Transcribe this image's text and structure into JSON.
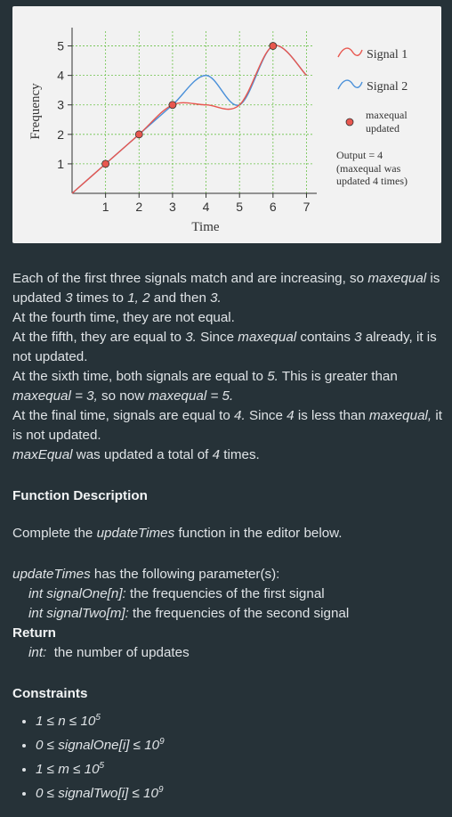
{
  "figure": {
    "ylabel": "Frequency",
    "xlabel": "Time",
    "legend": {
      "signal1": "Signal 1",
      "signal2": "Signal 2",
      "marker_line1": "maxequal",
      "marker_line2": "updated"
    },
    "annotation": {
      "line1": "Output = 4",
      "line2": "(maxequal was",
      "line3": "updated 4 times)"
    },
    "colors": {
      "signal1": "#e8574f",
      "signal2": "#4a90d9",
      "marker": "#e8574f",
      "marker_edge": "#333333"
    }
  },
  "chart_data": {
    "type": "line",
    "xlabel": "Time",
    "ylabel": "Frequency",
    "x_ticks": [
      1,
      2,
      3,
      4,
      5,
      6,
      7
    ],
    "y_ticks": [
      1,
      2,
      3,
      4,
      5
    ],
    "xlim": [
      0,
      7.2
    ],
    "ylim": [
      0,
      5.5
    ],
    "grid": true,
    "legend_position": "right",
    "series": [
      {
        "name": "Signal 1",
        "x": [
          1,
          2,
          3,
          4,
          5,
          6,
          7
        ],
        "y": [
          1,
          2,
          3,
          3,
          3,
          5,
          4
        ]
      },
      {
        "name": "Signal 2",
        "x": [
          1,
          2,
          3,
          4,
          5,
          6,
          7
        ],
        "y": [
          1,
          2,
          3,
          4,
          3,
          5,
          4
        ]
      }
    ],
    "markers": {
      "name": "maxequal updated",
      "x": [
        1,
        2,
        3,
        6
      ],
      "y": [
        1,
        2,
        3,
        5
      ]
    }
  },
  "text": {
    "p1a": "Each of the first three signals match and are increasing, so ",
    "p1_var": "maxequal",
    "p1b": " is updated ",
    "p1_3": "3",
    "p1c": " times to ",
    "p1_vals": "1, 2",
    "p1d": " and then ",
    "p1_3b": "3.",
    "p2": "At the fourth time, they are not equal.",
    "p3a": "At the fifth, they are equal to ",
    "p3_3": "3.",
    "p3b": " Since ",
    "p3_var": "maxequal",
    "p3c": " contains ",
    "p3_3b": "3",
    "p3d": " already, it is not updated.",
    "p4a": "At the sixth time, both signals are equal to ",
    "p4_5": "5.",
    "p4b": " This is greater than ",
    "p4_eq1": "maxequal = 3,",
    "p4c": " so now ",
    "p4_eq2": "maxequal = 5.",
    "p5a": "At the final time, signals are equal to ",
    "p5_4": "4.",
    "p5b": " Since ",
    "p5_4b": "4",
    "p5c": " is less than ",
    "p5_var": "maxequal,",
    "p5d": " it is not updated.",
    "p6_var": "maxEqual",
    "p6a": " was updated a total of ",
    "p6_4": "4",
    "p6b": " times.",
    "func_heading": "Function Description",
    "func_a": "Complete the ",
    "func_name": "updateTimes",
    "func_b": " function in the editor below.",
    "params_name": "updateTimes",
    "params_b": " has the following parameter(s):",
    "param1_sig": "int signalOne[n]:",
    "param1_desc": " the frequencies of the first signal",
    "param2_sig": "int signalTwo[m]:",
    "param2_desc": " the frequencies of the second signal",
    "return_heading": "Return",
    "return_sig": "int:",
    "return_desc": "  the number of updates",
    "constraints_heading": "Constraints",
    "c1a": "1 ≤ n ≤ 10",
    "c1sup": "5",
    "c2a": "0 ≤ signalOne[i] ≤ 10",
    "c2sup": "9",
    "c3a": "1 ≤ m ≤ 10",
    "c3sup": "5",
    "c4a": "0 ≤ signalTwo[i] ≤ 10",
    "c4sup": "9"
  }
}
